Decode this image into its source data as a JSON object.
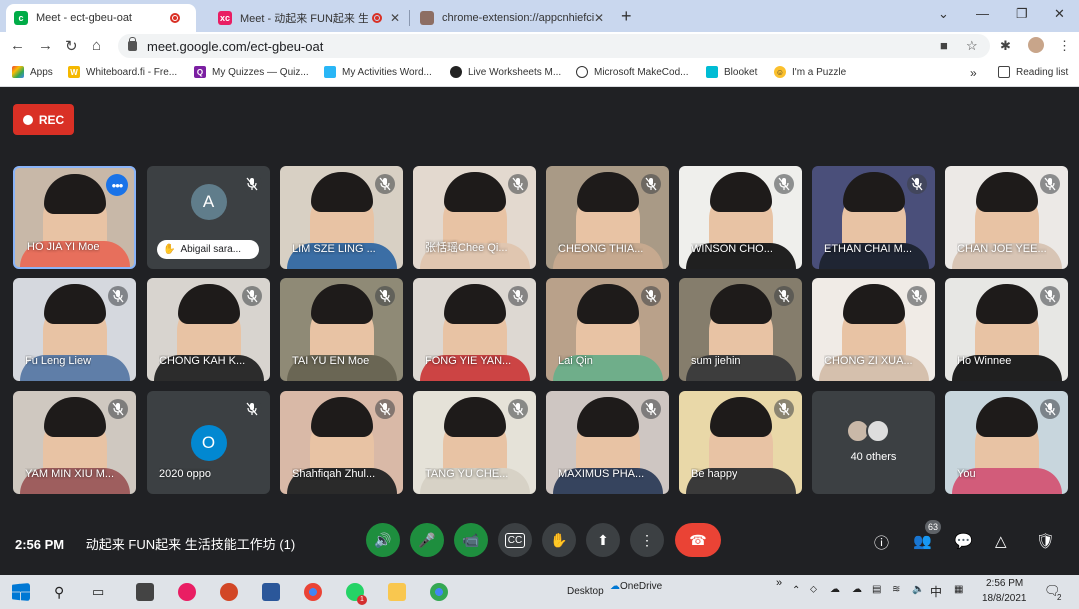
{
  "browser": {
    "tabs": [
      {
        "title": "Meet - ect-gbeu-oat",
        "favicon": "meet-icon",
        "color": "#00ac47",
        "recording": true
      },
      {
        "title": "Meet - 动起来 FUN起来 生活",
        "favicon": "xc-icon",
        "color": "#e91e63",
        "recording": true
      },
      {
        "title": "chrome-extension://appcnhiefcid",
        "favicon": "extension-icon",
        "color": "#8d6e63",
        "recording": false
      }
    ],
    "url": "meet.google.com/ect-gbeu-oat",
    "bookmarks": [
      {
        "label": "Apps",
        "icon": "apps-grid-icon"
      },
      {
        "label": "Whiteboard.fi - Fre...",
        "icon": "whiteboard-icon"
      },
      {
        "label": "My Quizzes — Quiz...",
        "icon": "quizizz-icon"
      },
      {
        "label": "My Activities Word...",
        "icon": "wordwall-icon"
      },
      {
        "label": "Live Worksheets M...",
        "icon": "liveworksheets-icon"
      },
      {
        "label": "Microsoft MakeCod...",
        "icon": "makecode-icon"
      },
      {
        "label": "Blooket",
        "icon": "blooket-icon"
      },
      {
        "label": "I'm a Puzzle",
        "icon": "puzzle-icon"
      }
    ],
    "bookmarks_more": "»",
    "reading_list": "Reading list"
  },
  "meet": {
    "rec_label": "REC",
    "participants": [
      {
        "name": "HO JIA YI Moe",
        "type": "video",
        "bg": "#c8b8a8",
        "shirt": "#e76f5c",
        "active": true
      },
      {
        "name": "Abigail sara...",
        "type": "avatar",
        "letter": "A",
        "avatar_color": "#607d8b",
        "hand_raised": true
      },
      {
        "name": "LIM SZE LING ...",
        "type": "video",
        "bg": "#d8d0c4",
        "shirt": "#3b6ea5"
      },
      {
        "name": "张恬瑶Chee Qi...",
        "type": "video",
        "bg": "#e3d9cf",
        "shirt": "#e0c6b0"
      },
      {
        "name": "CHEONG THIA...",
        "type": "video",
        "bg": "#a99a86",
        "shirt": "#c6a98f"
      },
      {
        "name": "WINSON CHO...",
        "type": "video",
        "bg": "#efefec",
        "shirt": "#202020"
      },
      {
        "name": "ETHAN CHAI M...",
        "type": "video",
        "bg": "#4a4f7a",
        "shirt": "#1f2533"
      },
      {
        "name": "CHAN JOE YEE...",
        "type": "video",
        "bg": "#ece9e6",
        "shirt": "#d8c5b5"
      },
      {
        "name": "Fu Leng Liew",
        "type": "video",
        "bg": "#d5d8de",
        "shirt": "#5f7ea8"
      },
      {
        "name": "CHONG KAH K...",
        "type": "video",
        "bg": "#d8d4cf",
        "shirt": "#2c2c2c"
      },
      {
        "name": "TAI YU EN Moe",
        "type": "video",
        "bg": "#8f8a76",
        "shirt": "#6a6654"
      },
      {
        "name": "FONG YIE YAN...",
        "type": "video",
        "bg": "#ddd8d2",
        "shirt": "#cc4444"
      },
      {
        "name": "Lai Qin",
        "type": "video",
        "bg": "#b9a18a",
        "shirt": "#6fae8a"
      },
      {
        "name": "sum jiehin",
        "type": "video",
        "bg": "#857d6c",
        "shirt": "#3d3d3d"
      },
      {
        "name": "CHONG ZI XUA...",
        "type": "video",
        "bg": "#f0ebe6",
        "shirt": "#d5c0ad"
      },
      {
        "name": "Ho Winnee",
        "type": "video",
        "bg": "#e7e7e4",
        "shirt": "#202020"
      },
      {
        "name": "YAM MIN XIU M...",
        "type": "video",
        "bg": "#cfc8c0",
        "shirt": "#9e5e5e"
      },
      {
        "name": "2020 oppo",
        "type": "avatar",
        "letter": "O",
        "avatar_color": "#0288d1"
      },
      {
        "name": "Shahfiqah Zhul...",
        "type": "video",
        "bg": "#d9b9a7",
        "shirt": "#2a2a2a"
      },
      {
        "name": "TANG YU CHE...",
        "type": "video",
        "bg": "#e5e2d8",
        "shirt": "#d7d2c6"
      },
      {
        "name": "MAXIMUS PHA...",
        "type": "video",
        "bg": "#cec6c2",
        "shirt": "#36445e"
      },
      {
        "name": "Be happy",
        "type": "video",
        "bg": "#e9d8a8",
        "shirt": "#3a3a3a"
      },
      {
        "name": "40 others",
        "type": "others"
      },
      {
        "name": "You",
        "type": "video",
        "bg": "#c8d6dd",
        "shirt": "#d25c7a"
      }
    ],
    "time": "2:56 PM",
    "meeting_title": "动起来 FUN起来 生活技能工作坊 (1)",
    "participant_count": "63",
    "controls": [
      {
        "name": "volume-button",
        "icon": "speaker-icon",
        "glyph": "🔊",
        "style": "green"
      },
      {
        "name": "mic-button",
        "icon": "mic-icon",
        "glyph": "🎤",
        "style": "green"
      },
      {
        "name": "camera-button",
        "icon": "camera-icon",
        "glyph": "📹",
        "style": "green"
      },
      {
        "name": "captions-button",
        "icon": "captions-icon",
        "glyph": "CC",
        "style": "grey"
      },
      {
        "name": "raise-hand-button",
        "icon": "hand-icon",
        "glyph": "✋",
        "style": "grey"
      },
      {
        "name": "present-button",
        "icon": "present-icon",
        "glyph": "⬆",
        "style": "grey"
      },
      {
        "name": "more-options-button",
        "icon": "more-vert-icon",
        "glyph": "⋮",
        "style": "grey"
      },
      {
        "name": "leave-call-button",
        "icon": "end-call-icon",
        "glyph": "☎",
        "style": "red"
      }
    ]
  },
  "taskbar": {
    "desktop_label": "Desktop",
    "onedrive_label": "OneDrive",
    "clock_time": "2:56 PM",
    "clock_date": "18/8/2021",
    "input_lang": "中",
    "notifications": "2",
    "whatsapp_badge": "1"
  }
}
